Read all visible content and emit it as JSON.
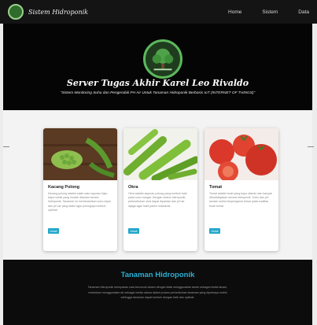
{
  "navbar": {
    "brand": "Sistem Hidroponik",
    "links": [
      "Home",
      "Sistem",
      "Data"
    ]
  },
  "hero": {
    "title": "Server Tugas Akhir Karel Leo Rivaldo",
    "subtitle": "\"Sistem Monitoring Suhu dan Pengendali PH Air Untuk Tanaman Hidroponik Berbasis IoT (INTERNET OF THINGS)\""
  },
  "cards": [
    {
      "title": "Kacang Polong",
      "text": "Kacang polong adalah salah satu sayuran hijau kaya nutrisi yang mudah ditanam secara hidroponik. Tanaman ini membutuhkan suhu sejuk dan pH air yang stabil agar polongnya tumbuh optimal.",
      "button": "Detail",
      "icon": "peas-photo"
    },
    {
      "title": "Okra",
      "text": "Okra adalah sayuran polong yang tumbuh baik pada suhu hangat. Dengan sistem hidroponik, pertumbuhan okra dapat dipantau dan pH air dijaga agar hasil panen maksimal.",
      "button": "Detail",
      "icon": "okra-photo"
    },
    {
      "title": "Tomat",
      "text": "Tomat adalah buah yang kaya vitamin dan banyak dibudidayakan secara hidroponik. Suhu dan pH larutan nutrisi berpengaruh besar pada kualitas buah tomat.",
      "button": "Detail",
      "icon": "tomato-photo"
    }
  ],
  "footer": {
    "title": "Tanaman Hidroponik",
    "text": "Tanaman hidroponik merupakan cara bercocok tanam dengan tidak menggunakan tanah sebagai media tanam, melainkan menggunakan air sebagai media utama dalam proses pertumbuhan tanaman yang diperkaya nutrisi sehingga tanaman dapat tumbuh dengan baik dan optimal."
  }
}
